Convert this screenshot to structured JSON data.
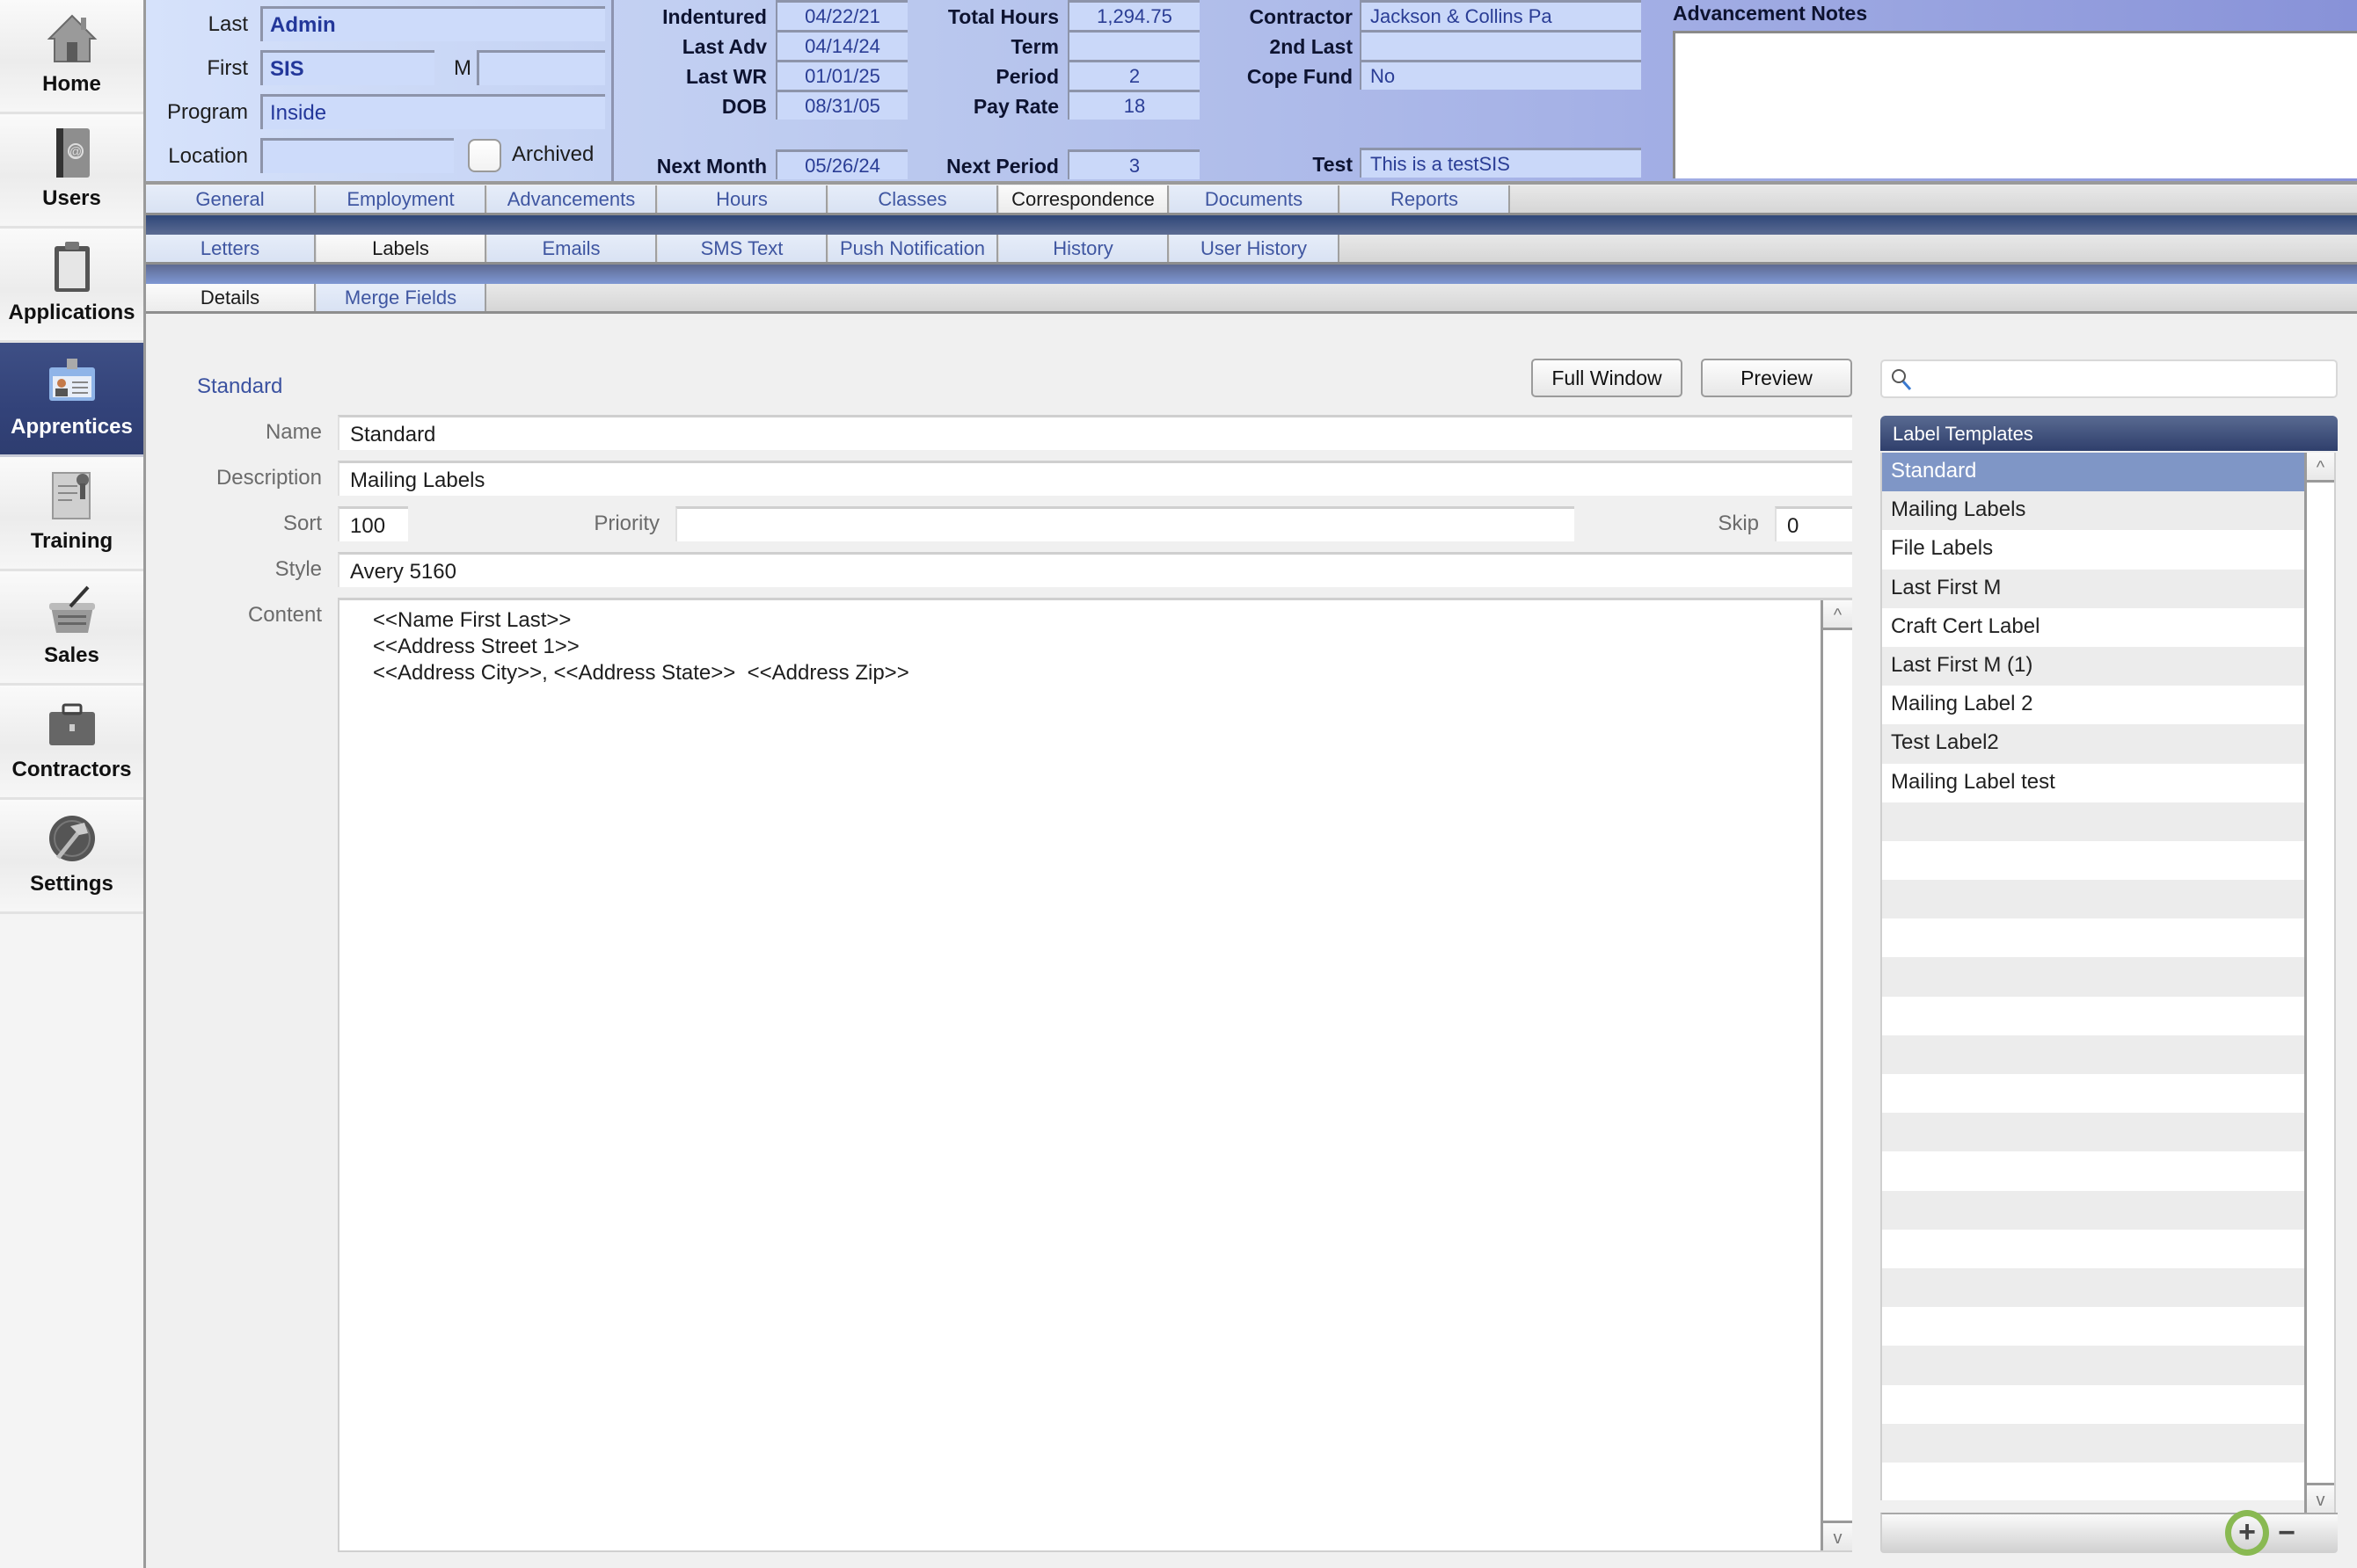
{
  "sidebar": {
    "items": [
      {
        "label": "Home",
        "icon": "house-icon"
      },
      {
        "label": "Users",
        "icon": "address-book-icon"
      },
      {
        "label": "Applications",
        "icon": "clipboard-icon"
      },
      {
        "label": "Apprentices",
        "icon": "id-badge-icon",
        "active": true
      },
      {
        "label": "Training",
        "icon": "certificate-icon"
      },
      {
        "label": "Sales",
        "icon": "basket-icon"
      },
      {
        "label": "Contractors",
        "icon": "briefcase-icon"
      },
      {
        "label": "Settings",
        "icon": "hammer-globe-icon"
      }
    ]
  },
  "header": {
    "last_label": "Last",
    "last_value": "Admin",
    "first_label": "First",
    "first_value": "SIS",
    "m_label": "M",
    "m_value": "",
    "program_label": "Program",
    "program_value": "Inside",
    "location_label": "Location",
    "location_value": "",
    "archived_label": "Archived",
    "archived_checked": false,
    "indentured_label": "Indentured",
    "indentured_value": "04/22/21",
    "last_adv_label": "Last Adv",
    "last_adv_value": "04/14/24",
    "last_wr_label": "Last WR",
    "last_wr_value": "01/01/25",
    "dob_label": "DOB",
    "dob_value": "08/31/05",
    "next_month_label": "Next Month",
    "next_month_value": "05/26/24",
    "total_hours_label": "Total Hours",
    "total_hours_value": "1,294.75",
    "term_label": "Term",
    "term_value": "",
    "period_label": "Period",
    "period_value": "2",
    "pay_rate_label": "Pay Rate",
    "pay_rate_value": "18",
    "next_period_label": "Next Period",
    "next_period_value": "3",
    "contractor_label": "Contractor",
    "contractor_value": "Jackson & Collins Pa",
    "second_last_label": "2nd Last",
    "second_last_value": "",
    "cope_fund_label": "Cope Fund",
    "cope_fund_value": "No",
    "test_label": "Test",
    "test_value": "This is a testSIS",
    "notes_title": "Advancement Notes",
    "notes_value": ""
  },
  "tabs": {
    "main": [
      "General",
      "Employment",
      "Advancements",
      "Hours",
      "Classes",
      "Correspondence",
      "Documents",
      "Reports"
    ],
    "main_active": "Correspondence",
    "sub": [
      "Letters",
      "Labels",
      "Emails",
      "SMS Text",
      "Push Notification",
      "History",
      "User History"
    ],
    "sub_active": "Labels",
    "detail": [
      "Details",
      "Merge Fields"
    ],
    "detail_active": "Details"
  },
  "form": {
    "record_title": "Standard",
    "full_window_label": "Full Window",
    "preview_label": "Preview",
    "name_label": "Name",
    "name_value": "Standard",
    "description_label": "Description",
    "description_value": "Mailing Labels",
    "sort_label": "Sort",
    "sort_value": "100",
    "priority_label": "Priority",
    "priority_value": "",
    "skip_label": "Skip",
    "skip_value": "0",
    "style_label": "Style",
    "style_value": "Avery 5160",
    "content_label": "Content",
    "content_value": "<<Name First Last>>\n<<Address Street 1>>\n<<Address City>>, <<Address State>>  <<Address Zip>>"
  },
  "templates": {
    "search_placeholder": "",
    "title": "Label Templates",
    "items": [
      "Standard",
      "Mailing Labels",
      "File Labels",
      "Last First M",
      "Craft Cert Label",
      "Last First M (1)",
      "Mailing Label 2",
      "Test Label2",
      "Mailing Label test"
    ],
    "selected": "Standard",
    "add_label": "+",
    "remove_label": "−"
  },
  "colors": {
    "accent": "#33437a",
    "selection": "#7f96c6",
    "field_text": "#23379a",
    "add_highlight": "#89b952"
  }
}
